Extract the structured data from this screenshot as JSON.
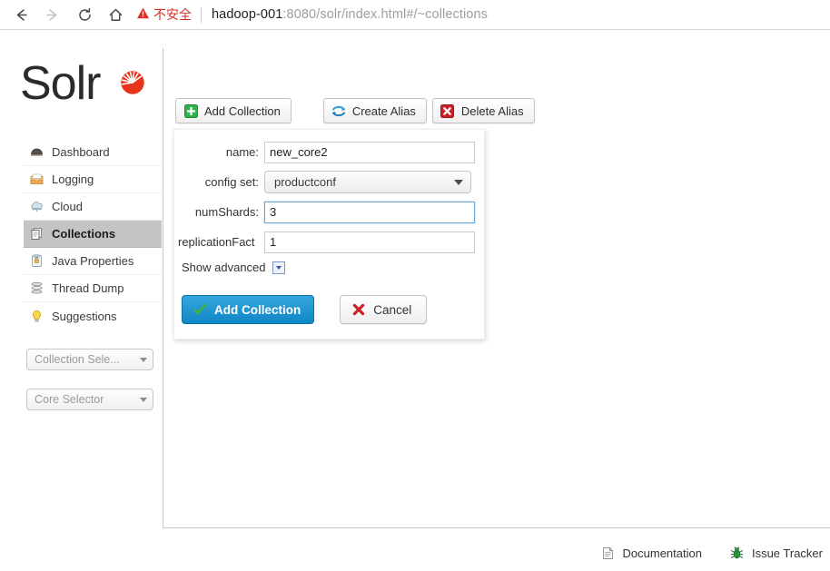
{
  "browser": {
    "nav": {
      "back_icon": "arrow-left-icon",
      "forward_icon": "arrow-right-icon",
      "reload_icon": "reload-icon",
      "home_icon": "home-icon"
    },
    "security": {
      "icon": "warning-triangle-icon",
      "label": "不安全",
      "color": "#d93025"
    },
    "url": {
      "host": "hadoop-001",
      "path": ":8080/solr/index.html#/~collections"
    }
  },
  "sidebar": {
    "logo": {
      "text": "Solr",
      "icon": "solr-sunburst-logo",
      "color": "#e02020"
    },
    "items": [
      {
        "label": "Dashboard",
        "icon": "dashboard-icon",
        "active": false
      },
      {
        "label": "Logging",
        "icon": "logging-icon",
        "active": false
      },
      {
        "label": "Cloud",
        "icon": "cloud-icon",
        "active": false
      },
      {
        "label": "Collections",
        "icon": "collections-icon",
        "active": true
      },
      {
        "label": "Java Properties",
        "icon": "java-properties-icon",
        "active": false
      },
      {
        "label": "Thread Dump",
        "icon": "thread-dump-icon",
        "active": false
      },
      {
        "label": "Suggestions",
        "icon": "suggestions-lightbulb-icon",
        "active": false
      }
    ],
    "collection_selector": {
      "label": "Collection Sele...",
      "caret_icon": "chevron-down-icon"
    },
    "core_selector": {
      "label": "Core Selector",
      "caret_icon": "chevron-down-icon"
    }
  },
  "toolbar": {
    "add_collection": {
      "label": "Add Collection",
      "icon": "plus-green-icon"
    },
    "create_alias": {
      "label": "Create Alias",
      "icon": "alias-arrows-icon"
    },
    "delete_alias": {
      "label": "Delete Alias",
      "icon": "delete-red-x-icon"
    }
  },
  "form": {
    "fields": {
      "name": {
        "label": "name:",
        "value": "new_core2",
        "focused": false
      },
      "config_set": {
        "label": "config set:",
        "value": "productconf",
        "caret_icon": "chevron-down-icon"
      },
      "num_shards": {
        "label": "numShards:",
        "value": "3",
        "focused": true
      },
      "replication_factor": {
        "label": "replicationFact",
        "value": "1",
        "focused": false
      }
    },
    "show_advanced": {
      "label": "Show advanced",
      "toggle_icon": "expand-toggle-icon"
    },
    "submit": {
      "label": "Add Collection",
      "icon": "check-green-icon"
    },
    "cancel": {
      "label": "Cancel",
      "icon": "cancel-red-x-icon"
    }
  },
  "footer": {
    "documentation": {
      "label": "Documentation",
      "icon": "document-icon"
    },
    "issue_tracker": {
      "label": "Issue Tracker",
      "icon": "bug-green-icon"
    }
  }
}
